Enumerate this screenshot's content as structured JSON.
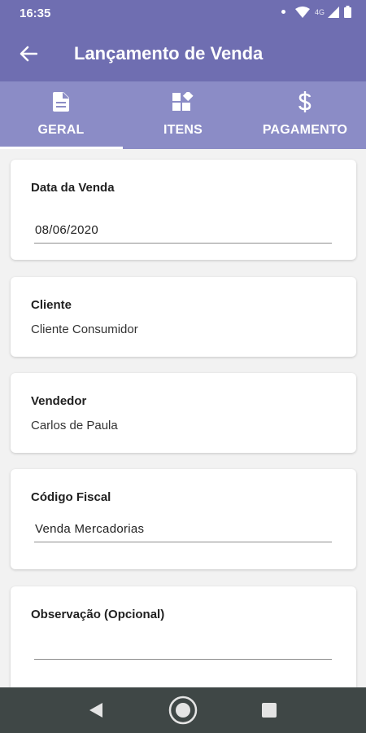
{
  "status_bar": {
    "time": "16:35",
    "network": "4G",
    "icons": [
      "notification-dot-icon",
      "wifi-icon",
      "signal-icon",
      "battery-icon"
    ]
  },
  "app_bar": {
    "title": "Lançamento de Venda",
    "back_icon": "arrow-back-icon"
  },
  "tabs": [
    {
      "label": "GERAL",
      "icon": "document-icon",
      "selected": true
    },
    {
      "label": "ITENS",
      "icon": "widgets-icon",
      "selected": false
    },
    {
      "label": "PAGAMENTO",
      "icon": "dollar-icon",
      "selected": false
    }
  ],
  "form": {
    "data_venda": {
      "label": "Data da Venda",
      "value": "08/06/2020"
    },
    "cliente": {
      "label": "Cliente",
      "value": "Cliente Consumidor"
    },
    "vendedor": {
      "label": "Vendedor",
      "value": "Carlos de Paula"
    },
    "codigo_fiscal": {
      "label": "Código Fiscal",
      "value": "Venda Mercadorias"
    },
    "observacao": {
      "label": "Observação (Opcional)",
      "value": ""
    }
  },
  "nav_bar": {
    "icons": [
      "back-triangle-icon",
      "home-circle-icon",
      "recents-square-icon"
    ]
  },
  "colors": {
    "primary": "#6f6eb1",
    "tab_bar": "#8b8cc6",
    "background": "#f2f2f2",
    "nav_bar": "#3f4746"
  }
}
